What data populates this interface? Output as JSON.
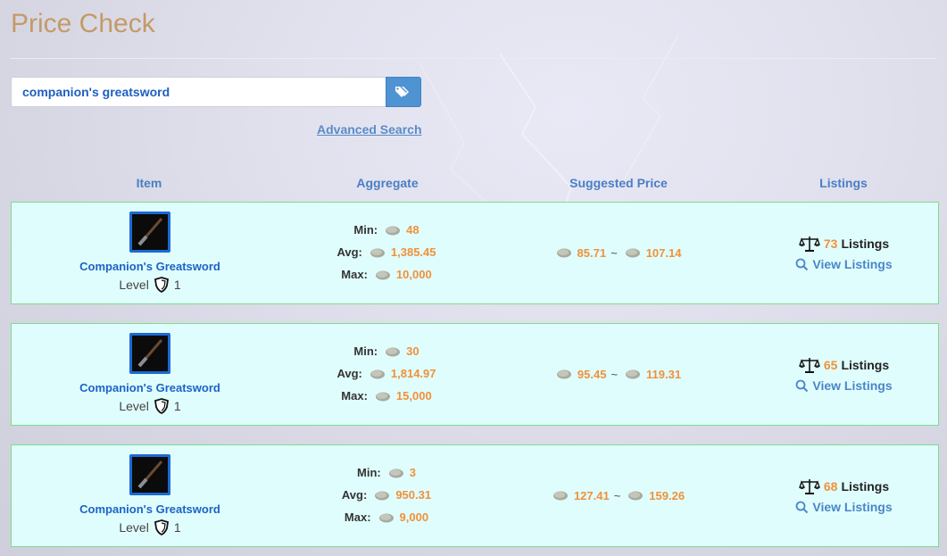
{
  "page": {
    "title": "Price Check"
  },
  "search": {
    "value": "companion's greatsword",
    "advanced_label": "Advanced Search"
  },
  "columns": {
    "item": "Item",
    "aggregate": "Aggregate",
    "suggested": "Suggested Price",
    "listings": "Listings"
  },
  "labels": {
    "min": "Min:",
    "avg": "Avg:",
    "max": "Max:",
    "level": "Level",
    "listings_word": "Listings",
    "view_listings": "View Listings",
    "tilde": "~"
  },
  "rows": [
    {
      "name": "Companion's Greatsword",
      "level": "1",
      "min": "48",
      "avg": "1,385.45",
      "max": "10,000",
      "suggest_low": "85.71",
      "suggest_high": "107.14",
      "listings": "73"
    },
    {
      "name": "Companion's Greatsword",
      "level": "1",
      "min": "30",
      "avg": "1,814.97",
      "max": "15,000",
      "suggest_low": "95.45",
      "suggest_high": "119.31",
      "listings": "65"
    },
    {
      "name": "Companion's Greatsword",
      "level": "1",
      "min": "3",
      "avg": "950.31",
      "max": "9,000",
      "suggest_low": "127.41",
      "suggest_high": "159.26",
      "listings": "68"
    }
  ],
  "icons": {
    "search_button": "tags-icon",
    "coin": "silver-coin-icon",
    "level": "shield-icon",
    "listings": "scales-icon",
    "view": "magnifier-icon"
  },
  "colors": {
    "title": "#c49a66",
    "link": "#4a86c8",
    "price": "#f0913a",
    "row_bg": "#e0fdfd",
    "row_border": "#7fdc8a",
    "button": "#4f93d2"
  }
}
